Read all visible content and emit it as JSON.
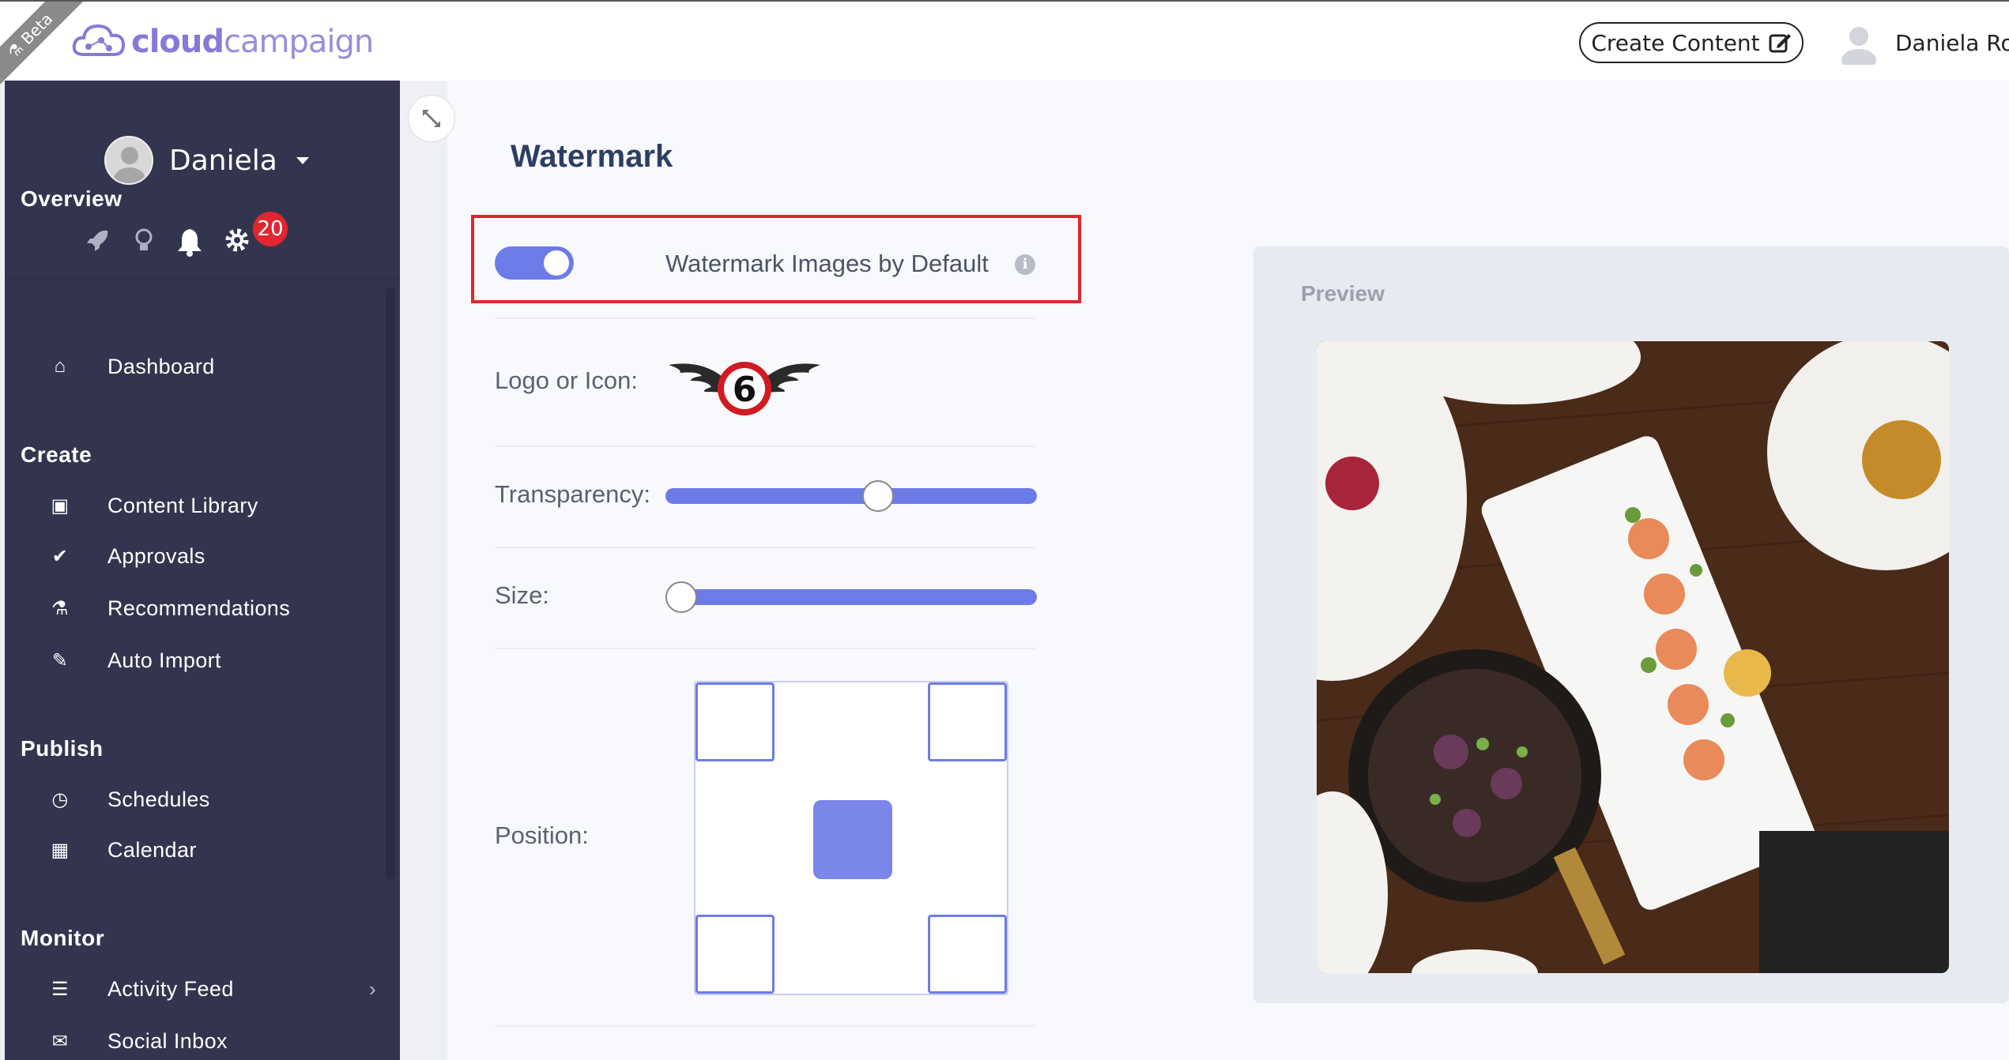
{
  "header": {
    "beta_label": "Beta",
    "logo_part1": "cloud",
    "logo_part2": "campaign",
    "create_button": "Create Content",
    "user_name": "Daniela Ros"
  },
  "sidebar": {
    "profile_name": "Daniela",
    "notification_count": "20",
    "sections": {
      "overview": {
        "title": "Overview",
        "items": [
          {
            "label": "Dashboard",
            "icon": "home-icon"
          }
        ]
      },
      "create": {
        "title": "Create",
        "items": [
          {
            "label": "Content Library",
            "icon": "image-file-icon"
          },
          {
            "label": "Approvals",
            "icon": "check-circle-icon"
          },
          {
            "label": "Recommendations",
            "icon": "flask-icon"
          },
          {
            "label": "Auto Import",
            "icon": "magic-wand-icon"
          }
        ]
      },
      "publish": {
        "title": "Publish",
        "items": [
          {
            "label": "Schedules",
            "icon": "clock-icon"
          },
          {
            "label": "Calendar",
            "icon": "calendar-check-icon"
          }
        ]
      },
      "monitor": {
        "title": "Monitor",
        "items": [
          {
            "label": "Activity Feed",
            "icon": "list-icon"
          },
          {
            "label": "Social Inbox",
            "icon": "envelope-icon"
          }
        ]
      }
    }
  },
  "main": {
    "title": "Watermark",
    "toggle_label": "Watermark Images by Default",
    "toggle_on": true,
    "logo_label": "Logo or Icon:",
    "transparency_label": "Transparency:",
    "transparency_value": 0.58,
    "size_label": "Size:",
    "size_value": 0.0,
    "position_label": "Position:",
    "position_selected": "center",
    "preview_title": "Preview",
    "logo_mark_text": "6"
  },
  "colors": {
    "accent": "#6d7be8",
    "sidebar_bg": "#33354e",
    "badge_red": "#e0262f",
    "title_blue": "#2c3e64"
  }
}
